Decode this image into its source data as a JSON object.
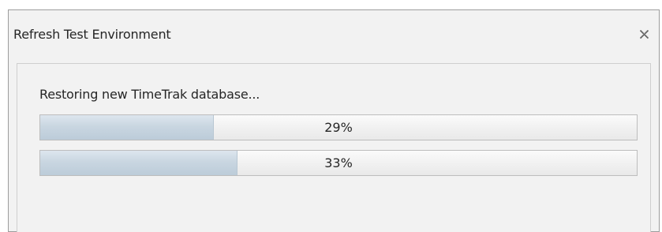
{
  "window": {
    "title": "Refresh Test Environment",
    "close_icon": "close-icon"
  },
  "dialog": {
    "status_text": "Restoring new TimeTrak database...",
    "progress_bars": [
      {
        "label": "29%",
        "value": 0.29
      },
      {
        "label": "33%",
        "value": 0.33
      }
    ]
  },
  "colors": {
    "progress_fill": "#c9d6e1",
    "window_background": "#f2f2f2"
  }
}
